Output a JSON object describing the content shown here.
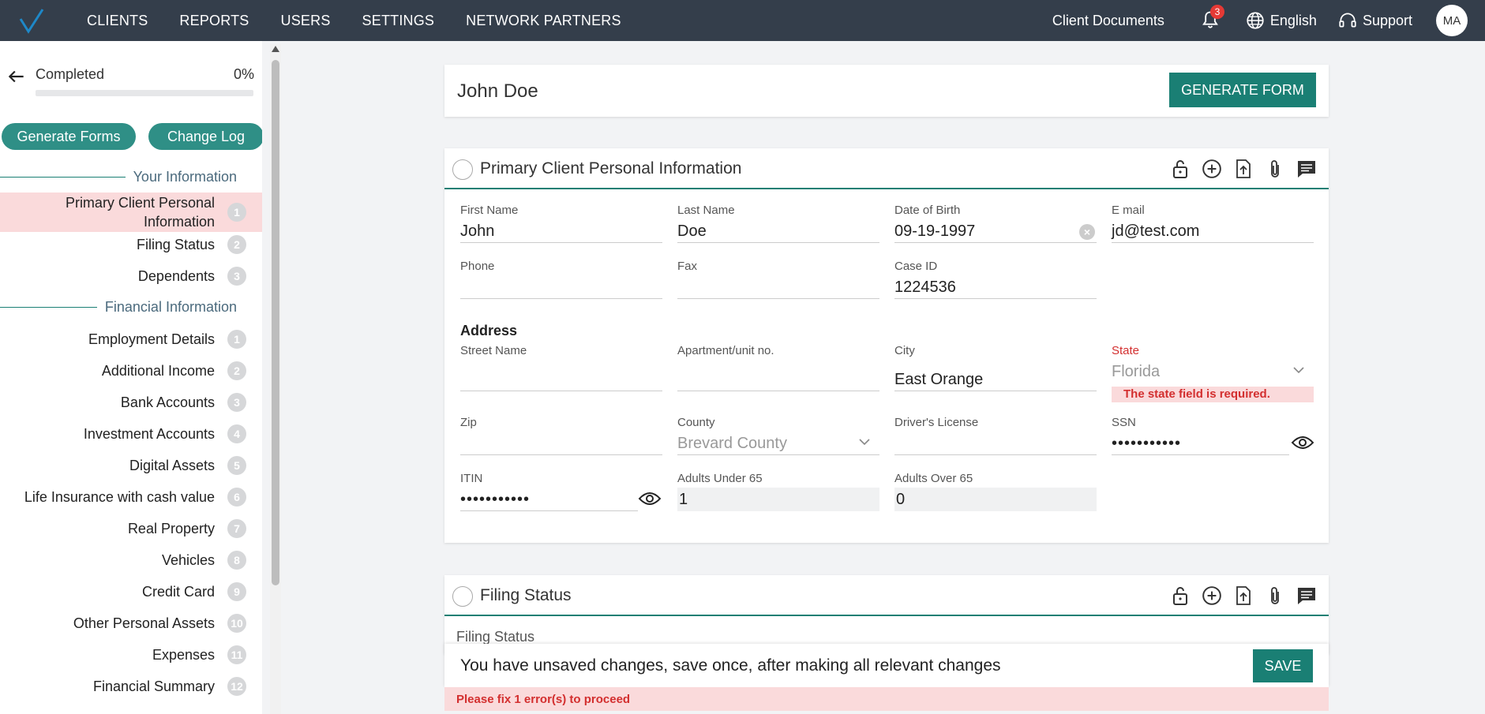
{
  "topbar": {
    "nav": [
      "CLIENTS",
      "REPORTS",
      "USERS",
      "SETTINGS",
      "NETWORK PARTNERS"
    ],
    "client_documents": "Client Documents",
    "notifications": "3",
    "language": "English",
    "support": "Support",
    "avatar": "MA"
  },
  "sidebar": {
    "progress_label": "Completed",
    "progress_pct": "0%",
    "progress_value": 0,
    "generate_forms": "Generate Forms",
    "change_log": "Change Log",
    "sections": [
      {
        "title": "Your Information",
        "items": [
          {
            "label": "Primary Client Personal Information",
            "num": "1"
          },
          {
            "label": "Filing Status",
            "num": "2"
          },
          {
            "label": "Dependents",
            "num": "3"
          }
        ]
      },
      {
        "title": "Financial Information",
        "items": [
          {
            "label": "Employment Details",
            "num": "1"
          },
          {
            "label": "Additional Income",
            "num": "2"
          },
          {
            "label": "Bank Accounts",
            "num": "3"
          },
          {
            "label": "Investment Accounts",
            "num": "4"
          },
          {
            "label": "Digital Assets",
            "num": "5"
          },
          {
            "label": "Life Insurance with cash value",
            "num": "6"
          },
          {
            "label": "Real Property",
            "num": "7"
          },
          {
            "label": "Vehicles",
            "num": "8"
          },
          {
            "label": "Credit Card",
            "num": "9"
          },
          {
            "label": "Other Personal Assets",
            "num": "10"
          },
          {
            "label": "Expenses",
            "num": "11"
          },
          {
            "label": "Financial Summary",
            "num": "12"
          }
        ]
      }
    ]
  },
  "client": {
    "name": "John Doe",
    "generate_form": "GENERATE FORM"
  },
  "personal_section": {
    "title": "Primary Client Personal Information",
    "fields": {
      "first_name": {
        "label": "First Name",
        "value": "John"
      },
      "last_name": {
        "label": "Last Name",
        "value": "Doe"
      },
      "dob": {
        "label": "Date of Birth",
        "value": "09-19-1997"
      },
      "email": {
        "label": "E mail",
        "value": "jd@test.com"
      },
      "phone": {
        "label": "Phone",
        "value": ""
      },
      "fax": {
        "label": "Fax",
        "value": ""
      },
      "case_id": {
        "label": "Case ID",
        "value": "1224536"
      },
      "address_heading": "Address",
      "street": {
        "label": "Street Name",
        "value": ""
      },
      "apartment": {
        "label": "Apartment/unit no.",
        "value": ""
      },
      "city": {
        "label": "City",
        "value": "East Orange"
      },
      "state": {
        "label": "State",
        "placeholder": "Florida",
        "error": "The state field is required."
      },
      "zip": {
        "label": "Zip",
        "value": ""
      },
      "county": {
        "label": "County",
        "placeholder": "Brevard County"
      },
      "drivers_license": {
        "label": "Driver's License",
        "value": ""
      },
      "ssn": {
        "label": "SSN",
        "value": "•••••••••••"
      },
      "itin": {
        "label": "ITIN",
        "value": "•••••••••••"
      },
      "adults_under": {
        "label": "Adults Under 65",
        "value": "1"
      },
      "adults_over": {
        "label": "Adults Over 65",
        "value": "0"
      }
    }
  },
  "filing_section": {
    "title": "Filing Status",
    "field_label": "Filing Status"
  },
  "save_bar": {
    "message": "You have unsaved changes, save once, after making all relevant changes",
    "save": "SAVE",
    "error": "Please fix 1 error(s) to proceed"
  },
  "colors": {
    "topbar": "#343e4b",
    "accent": "#1a7f74",
    "error": "#d32f2f",
    "error_bg": "#fadadb"
  }
}
